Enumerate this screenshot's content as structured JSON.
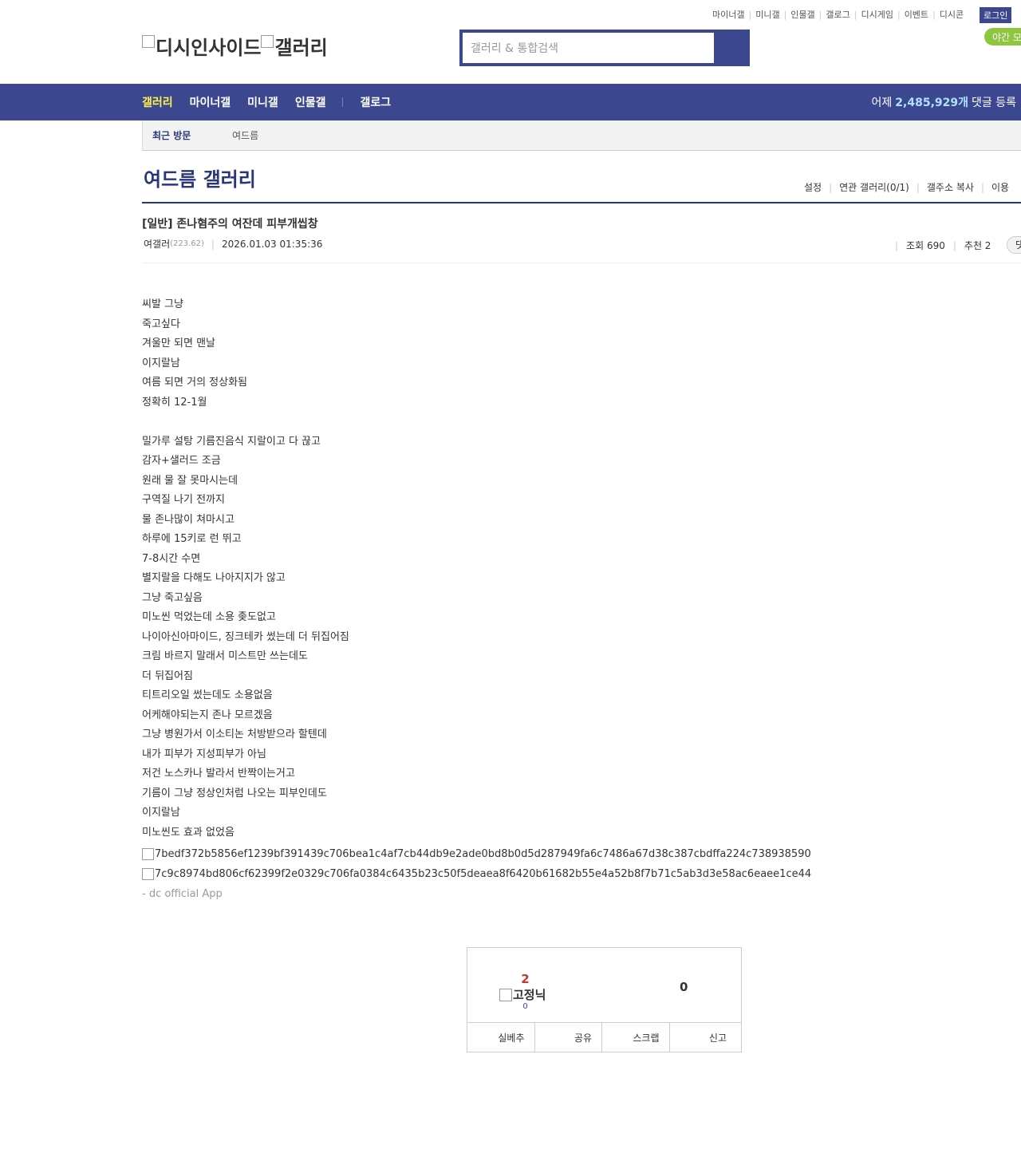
{
  "header": {
    "util_links": [
      "마이너갤",
      "미니갤",
      "인물갤",
      "갤로그",
      "디시게임",
      "이벤트",
      "디시콘"
    ],
    "login_label": "로그인",
    "night_mode_label": "야간 모드",
    "logo_main": "디시인사이드",
    "logo_sub": "갤러리",
    "search_placeholder": "갤러리 & 통합검색"
  },
  "nav": {
    "items": [
      "갤러리",
      "마이너갤",
      "미니갤",
      "인물갤",
      "갤로그"
    ],
    "stat_prefix": "어제",
    "stat_count": "2,485,929개",
    "stat_suffix": "댓글 등록"
  },
  "recent": {
    "label": "최근 방문",
    "item": "여드름"
  },
  "gallery": {
    "title": "여드름 갤러리",
    "menu": [
      "설정",
      "연관 갤러리(0/1)",
      "갤주소 복사",
      "이용"
    ]
  },
  "post": {
    "title": "[일반] 존나혐주의 여잔데 피부개씹창",
    "author": "여갤러",
    "ip": "(223.62)",
    "date": "2026.01.03 01:35:36",
    "views_label": "조회 690",
    "recommend_label": "추천 2",
    "comment_btn": "댓글",
    "body_lines": [
      "씨발 그냥",
      "죽고싶다",
      "겨울만 되면 맨날",
      "이지랄남",
      "여름 되면 거의 정상화됨",
      "정확히 12-1월",
      "",
      "밀가루 설탕 기름진음식 지랄이고 다 끊고",
      "감자+샐러드 조금",
      "원래 물 잘 못마시는데",
      "구역질 나기 전까지",
      "물 존나많이 쳐마시고",
      "하루에 15키로 런 뛰고",
      "7-8시간 수면",
      "별지랄을 다해도 나아지지가 않고",
      "그냥 죽고싶음",
      "미노씬 먹었는데 소용 좆도없고",
      "나이아신아마이드, 징크테카 썼는데 더 뒤집어짐",
      "크림 바르지 말래서 미스트만 쓰는데도",
      "더 뒤집어짐",
      "티트리오일 썼는데도 소용없음",
      "어케해야되는지 존나 모르겠음",
      "그냥 병원가서 이소티논 처방받으라 할텐데",
      "내가 피부가 지성피부가 아님",
      "저건 노스카나 발라서 반짝이는거고",
      "기름이 그냥 정상인처럼 나오는 피부인데도",
      "이지랄남",
      "미노씬도 효과 없었음"
    ],
    "image1_alt": "7bedf372b5856ef1239bf391439c706bea1c4af7cb44db9e2ade0bd8b0d5d287949fa6c7486a67d38c387cbdffa224c738938590",
    "image2_alt": "7c9c8974bd806cf62399f2e0329c706fa0384c6435b23c50f5deaea8f6420b61682b55e4a52b8f7b71c5ab3d3e58ac6eaee1ce44",
    "app_signature": "- dc official App"
  },
  "recommend_box": {
    "up_count": "2",
    "fixed_label": "고정닉",
    "fixed_count": "0",
    "down_count": "0",
    "buttons": [
      "실베추",
      "공유",
      "스크랩",
      "신고"
    ]
  }
}
